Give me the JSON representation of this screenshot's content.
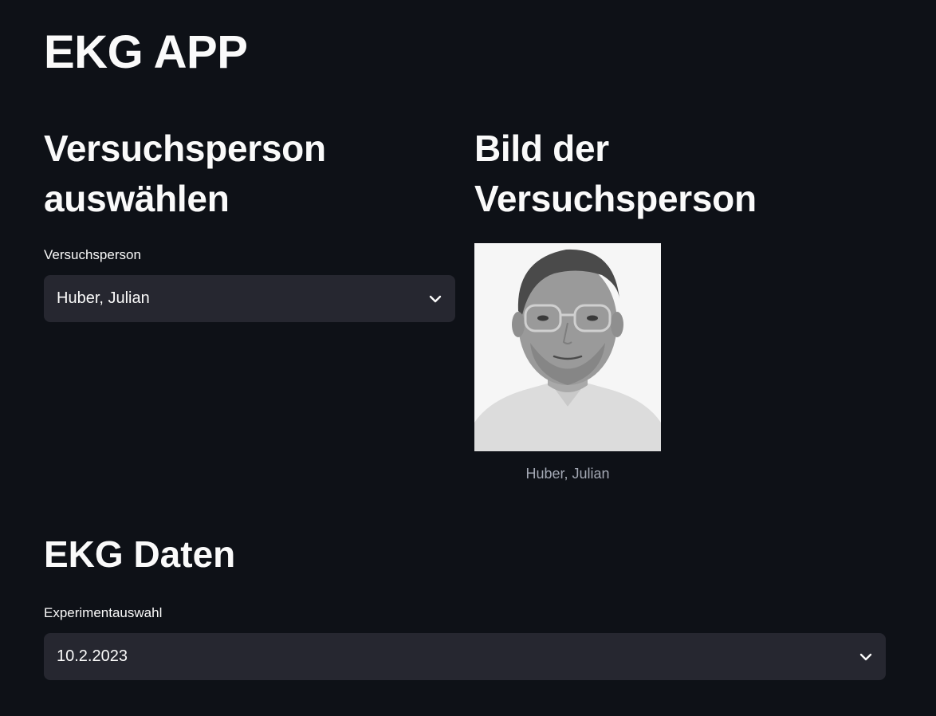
{
  "app": {
    "title": "EKG APP"
  },
  "subject_section": {
    "heading": "Versuchsperson auswählen",
    "select_label": "Versuchsperson",
    "selected_value": "Huber, Julian"
  },
  "image_section": {
    "heading": "Bild der Versuchsperson",
    "caption": "Huber, Julian"
  },
  "ekg_section": {
    "heading": "EKG Daten",
    "select_label": "Experimentauswahl",
    "selected_value": "10.2.2023"
  },
  "colors": {
    "background": "#0e1117",
    "select_background": "#262730",
    "text": "#fafafa",
    "caption": "#a3a8b4"
  },
  "icons": {
    "select_indicator": "chevron-down-icon"
  }
}
